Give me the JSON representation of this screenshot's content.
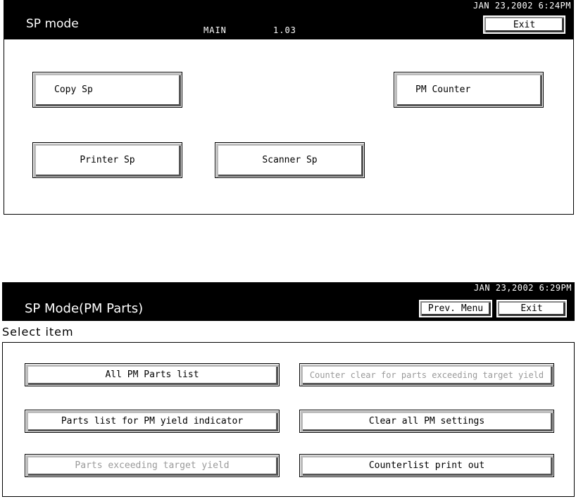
{
  "screen1": {
    "datetime": "JAN  23,2002  6:24PM",
    "title": "SP mode",
    "mode_label": "MAIN",
    "version": "1.03",
    "exit_label": "Exit",
    "buttons": {
      "copy_sp": "Copy Sp",
      "printer_sp": "Printer Sp",
      "scanner_sp": "Scanner Sp",
      "pm_counter": "PM Counter"
    }
  },
  "screen2": {
    "datetime": "JAN  23,2002  6:29PM",
    "title": "SP Mode(PM Parts)",
    "prev_menu_label": "Prev. Menu",
    "exit_label": "Exit",
    "select_item": "Select item",
    "buttons": {
      "all_pm_parts_list": "All PM Parts list",
      "parts_list_pm_yield": "Parts list for PM yield indicator",
      "parts_exceeding_target": "Parts exceeding target yield",
      "counter_clear_exceeding": "Counter clear for parts exceeding target yield",
      "clear_all_pm_settings": "Clear all PM settings",
      "counterlist_print_out": "Counterlist print out"
    }
  }
}
